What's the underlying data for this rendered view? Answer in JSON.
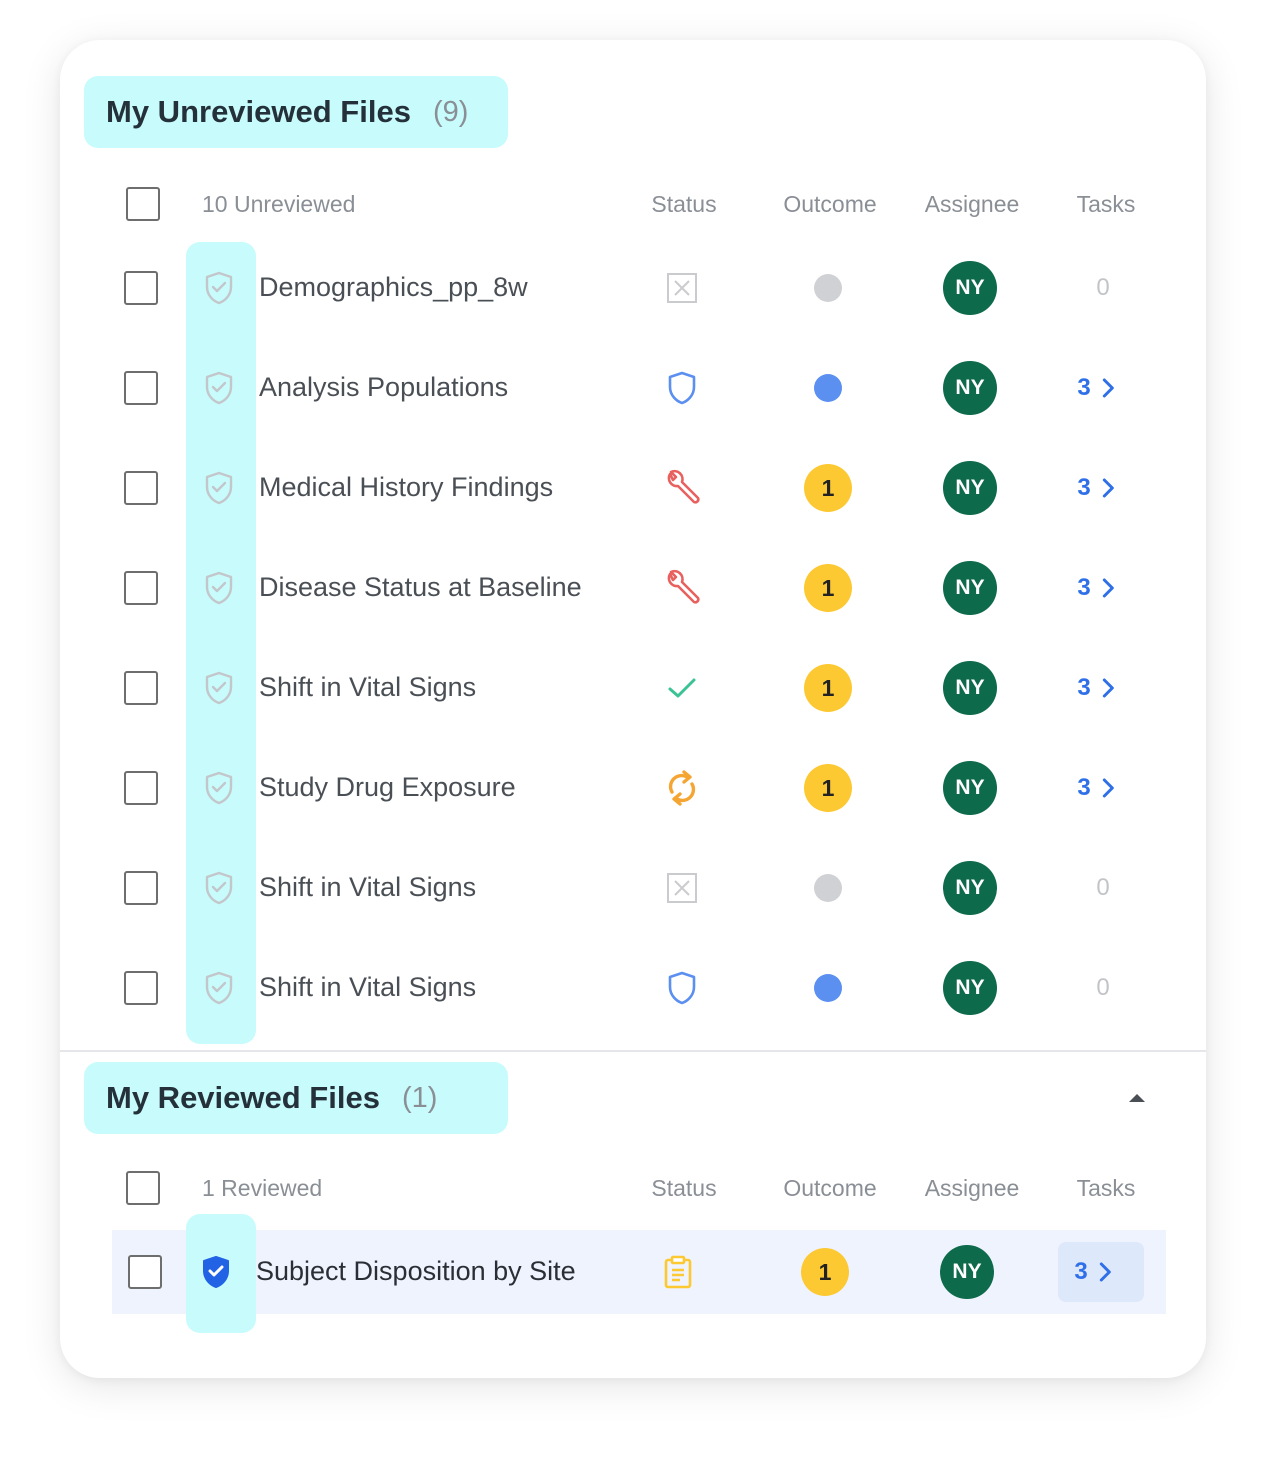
{
  "unreviewed": {
    "title": "My Unreviewed Files",
    "count": "(9)",
    "header": {
      "count_label": "10 Unreviewed",
      "status": "Status",
      "outcome": "Outcome",
      "assignee": "Assignee",
      "tasks": "Tasks"
    },
    "rows": [
      {
        "name": "Demographics_pp_8w",
        "status": "not-applicable-icon",
        "outcome": "grey-dot",
        "assignee": "NY",
        "tasks": "0"
      },
      {
        "name": "Analysis Populations",
        "status": "shield-icon",
        "outcome": "blue-dot",
        "assignee": "NY",
        "tasks": "3"
      },
      {
        "name": "Medical History Findings",
        "status": "wrench-icon",
        "outcome": "1",
        "assignee": "NY",
        "tasks": "3"
      },
      {
        "name": "Disease Status at Baseline",
        "status": "wrench-icon",
        "outcome": "1",
        "assignee": "NY",
        "tasks": "3"
      },
      {
        "name": "Shift in Vital Signs",
        "status": "check-icon",
        "outcome": "1",
        "assignee": "NY",
        "tasks": "3"
      },
      {
        "name": "Study Drug Exposure",
        "status": "refresh-icon",
        "outcome": "1",
        "assignee": "NY",
        "tasks": "3"
      },
      {
        "name": "Shift in Vital Signs",
        "status": "not-applicable-icon",
        "outcome": "grey-dot",
        "assignee": "NY",
        "tasks": "0"
      },
      {
        "name": "Shift in Vital Signs",
        "status": "shield-icon",
        "outcome": "blue-dot",
        "assignee": "NY",
        "tasks": "0"
      }
    ]
  },
  "reviewed": {
    "title": "My Reviewed Files",
    "count": "(1)",
    "header": {
      "count_label": "1 Reviewed",
      "status": "Status",
      "outcome": "Outcome",
      "assignee": "Assignee",
      "tasks": "Tasks"
    },
    "rows": [
      {
        "name": "Subject Disposition by Site",
        "status": "clipboard-icon",
        "outcome": "1",
        "assignee": "NY",
        "tasks": "3"
      }
    ]
  },
  "colors": {
    "highlight": "#c8fbfb",
    "avatar": "#0d6a4a",
    "outcome_badge": "#fcc933",
    "task_link": "#2f6fe8",
    "blue_dot": "#5b8ff0",
    "grey_dot": "#cfd1d4",
    "wrench": "#e8615f",
    "check": "#3cc395",
    "refresh": "#f5a531"
  }
}
